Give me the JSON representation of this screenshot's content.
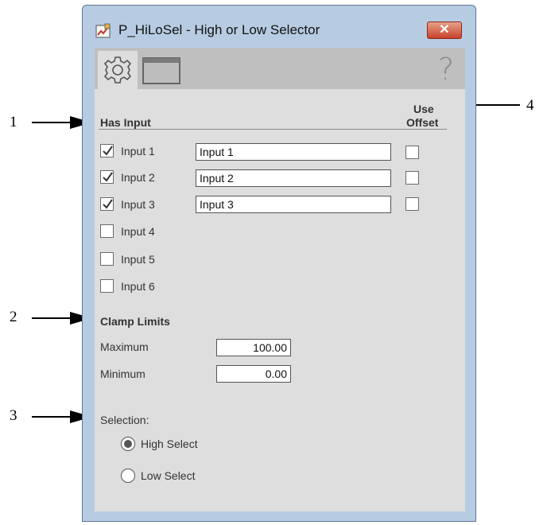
{
  "window": {
    "title": "P_HiLoSel - High or Low Selector",
    "close_label": "✕",
    "help_label": "?"
  },
  "callouts": [
    "1",
    "2",
    "3",
    "4"
  ],
  "inputs_section": {
    "header": "Has Input",
    "offset_header_line1": "Use",
    "offset_header_line2": "Offset",
    "rows": [
      {
        "label": "Input 1",
        "checked": true,
        "field": "Input 1",
        "has_field": true
      },
      {
        "label": "Input 2",
        "checked": true,
        "field": "Input 2",
        "has_field": true
      },
      {
        "label": "Input 3",
        "checked": true,
        "field": "Input 3",
        "has_field": true
      },
      {
        "label": "Input 4",
        "checked": false,
        "has_field": false
      },
      {
        "label": "Input 5",
        "checked": false,
        "has_field": false
      },
      {
        "label": "Input 6",
        "checked": false,
        "has_field": false
      }
    ]
  },
  "clamp": {
    "header": "Clamp Limits",
    "max_label": "Maximum",
    "max_value": "100.00",
    "min_label": "Minimum",
    "min_value": "0.00"
  },
  "selection": {
    "label": "Selection:",
    "high_label": "High Select",
    "low_label": "Low Select",
    "selected": "high"
  }
}
